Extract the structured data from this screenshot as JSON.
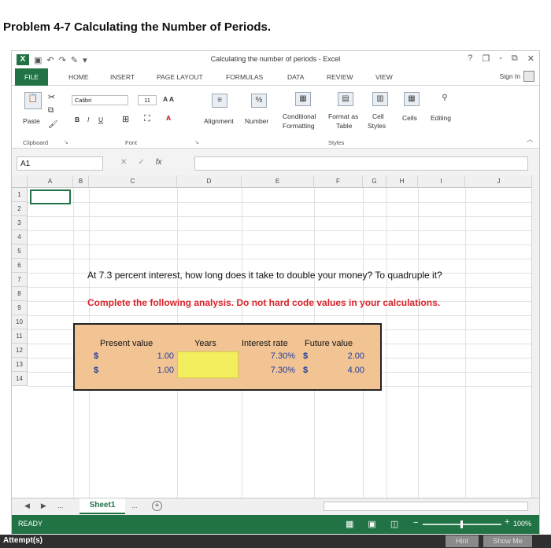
{
  "problem_title": "Problem 4-7 Calculating the Number of Periods.",
  "window": {
    "title": "Calculating the number of periods - Excel",
    "help": "?",
    "controls": [
      "-",
      "❐",
      "✕"
    ]
  },
  "tabs": [
    "FILE",
    "HOME",
    "INSERT",
    "PAGE LAYOUT",
    "FORMULAS",
    "DATA",
    "REVIEW",
    "VIEW"
  ],
  "sign_in": "Sign In",
  "ribbon": {
    "paste": "Paste",
    "clipboard": "Clipboard",
    "font_name": "Calibri",
    "font_size": "11",
    "grow_shrink": "A A",
    "bold": "B",
    "italic": "I",
    "underline": "U",
    "font_color": "A",
    "font_group": "Font",
    "alignment": "Alignment",
    "number": "Number",
    "percent": "%",
    "conditional": "Conditional",
    "formatting": "Formatting",
    "format_as": "Format as",
    "table": "Table",
    "cell": "Cell",
    "styles_btn": "Styles",
    "styles_group": "Styles",
    "cells": "Cells",
    "editing": "Editing"
  },
  "formula_bar": {
    "name_box": "A1",
    "fx": "fx"
  },
  "columns": [
    "A",
    "B",
    "C",
    "D",
    "E",
    "F",
    "G",
    "H",
    "I",
    "J"
  ],
  "rows": [
    "1",
    "2",
    "3",
    "4",
    "5",
    "6",
    "7",
    "8",
    "9",
    "10",
    "11",
    "12",
    "13",
    "14"
  ],
  "content": {
    "question": "At 7.3 percent interest, how long does it take to double your money? To quadruple it?",
    "instruction": "Complete the following analysis. Do not hard code values in your calculations."
  },
  "analysis": {
    "headers": {
      "present_value": "Present value",
      "years": "Years",
      "interest_rate": "Interest rate",
      "future_value": "Future value"
    },
    "currency": "$",
    "rows": [
      {
        "present_value": "1.00",
        "interest_rate": "7.30%",
        "future_value": "2.00"
      },
      {
        "present_value": "1.00",
        "interest_rate": "7.30%",
        "future_value": "4.00"
      }
    ]
  },
  "sheet": {
    "tab": "Sheet1",
    "more": "...",
    "add": "+"
  },
  "status": {
    "text": "READY",
    "zoom": "100%"
  },
  "bottom": {
    "attempts": "Attempt(s)",
    "hint": "Hint",
    "show_me": "Show Me"
  }
}
